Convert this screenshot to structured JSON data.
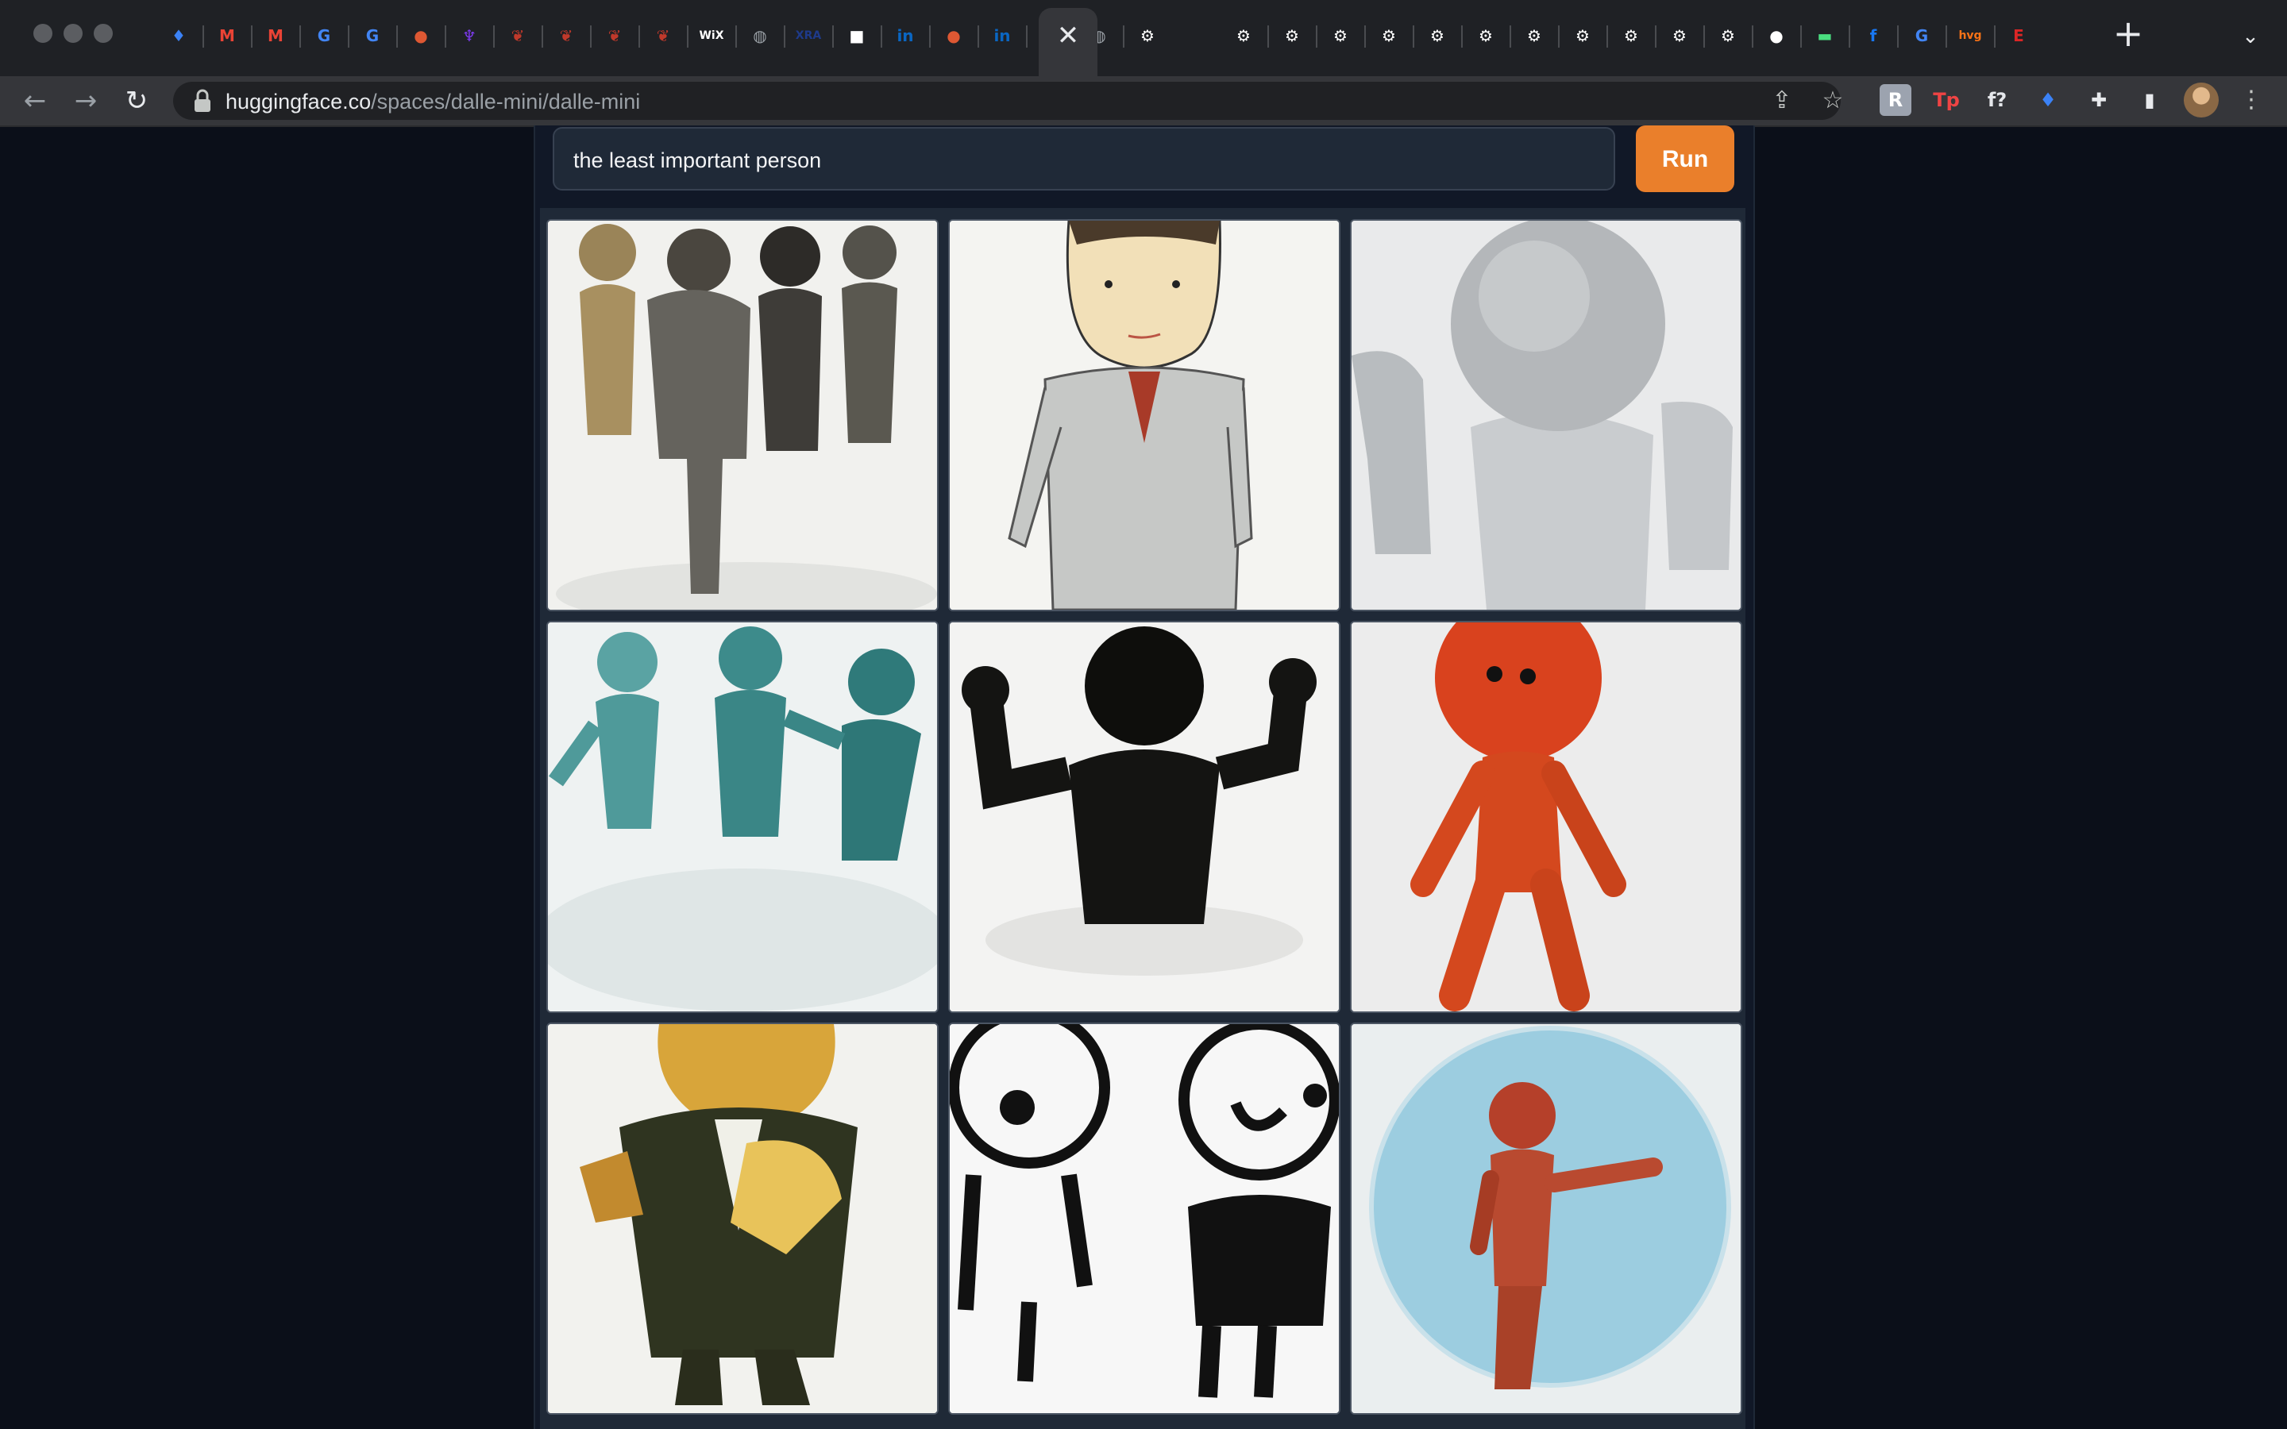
{
  "browser": {
    "active_tab_close_icon": "close-icon",
    "new_tab_label": "+",
    "url": {
      "domain": "huggingface.co",
      "path": "/spaces/dalle-mini/dalle-mini"
    },
    "tab_favicons": [
      {
        "icon": "diamond-icon",
        "text": "♦",
        "color": "#3b82f6"
      },
      {
        "icon": "gmail-icon",
        "text": "M",
        "color": "#ea4335"
      },
      {
        "icon": "gmail-icon",
        "text": "M",
        "color": "#ea4335"
      },
      {
        "icon": "google-icon",
        "text": "G",
        "color": "#4285f4"
      },
      {
        "icon": "google-icon",
        "text": "G",
        "color": "#4285f4"
      },
      {
        "icon": "duckduckgo-icon",
        "text": "●",
        "color": "#de5833"
      },
      {
        "icon": "purple-app-icon",
        "text": "♆",
        "color": "#7c3aed"
      },
      {
        "icon": "red-flag-icon",
        "text": "❦",
        "color": "#c0392b"
      },
      {
        "icon": "red-flag-icon",
        "text": "❦",
        "color": "#c0392b"
      },
      {
        "icon": "red-flag-icon",
        "text": "❦",
        "color": "#c0392b"
      },
      {
        "icon": "red-flag-icon",
        "text": "❦",
        "color": "#c0392b"
      },
      {
        "icon": "wix-icon",
        "text": "WiX",
        "color": "#ffffff"
      },
      {
        "icon": "globe-icon",
        "text": "◍",
        "color": "#9aa0a6"
      },
      {
        "icon": "xra-icon",
        "text": "XRA",
        "color": "#1e3a8a"
      },
      {
        "icon": "white-square-icon",
        "text": "■",
        "color": "#ffffff"
      },
      {
        "icon": "linkedin-icon",
        "text": "in",
        "color": "#0a66c2"
      },
      {
        "icon": "duckduckgo-icon",
        "text": "●",
        "color": "#de5833"
      },
      {
        "icon": "linkedin-icon",
        "text": "in",
        "color": "#0a66c2"
      },
      {
        "icon": "linkedin-icon",
        "text": "in",
        "color": "#0a66c2"
      },
      {
        "icon": "globe-icon",
        "text": "◍",
        "color": "#9aa0a6"
      },
      {
        "icon": "gear-icon",
        "text": "⚙",
        "color": "#ffffff"
      },
      {
        "icon": "gear-icon",
        "text": "⚙",
        "color": "#ffffff"
      },
      {
        "icon": "gear-icon",
        "text": "⚙",
        "color": "#ffffff"
      },
      {
        "icon": "gear-icon",
        "text": "⚙",
        "color": "#ffffff"
      },
      {
        "icon": "gear-icon",
        "text": "⚙",
        "color": "#ffffff"
      },
      {
        "icon": "gear-icon",
        "text": "⚙",
        "color": "#ffffff"
      },
      {
        "icon": "gear-icon",
        "text": "⚙",
        "color": "#ffffff"
      },
      {
        "icon": "gear-icon",
        "text": "⚙",
        "color": "#ffffff"
      },
      {
        "icon": "gear-icon",
        "text": "⚙",
        "color": "#ffffff"
      },
      {
        "icon": "gear-icon",
        "text": "⚙",
        "color": "#ffffff"
      },
      {
        "icon": "gear-icon",
        "text": "⚙",
        "color": "#ffffff"
      },
      {
        "icon": "gear-icon",
        "text": "⚙",
        "color": "#ffffff"
      },
      {
        "icon": "github-icon",
        "text": "●",
        "color": "#ffffff"
      },
      {
        "icon": "green-app-icon",
        "text": "▬",
        "color": "#4ade80"
      },
      {
        "icon": "facebook-icon",
        "text": "f",
        "color": "#1877f2"
      },
      {
        "icon": "google-icon",
        "text": "G",
        "color": "#4285f4"
      },
      {
        "icon": "hvg-icon",
        "text": "hvg",
        "color": "#f97316"
      },
      {
        "icon": "e-icon",
        "text": "E",
        "color": "#dc2626"
      }
    ],
    "extensions": [
      {
        "icon": "r-extension-icon",
        "text": "R",
        "color": "#d1d5db"
      },
      {
        "icon": "tp-extension-icon",
        "text": "Tp",
        "color": "#ef4444"
      },
      {
        "icon": "function-extension-icon",
        "text": "f?",
        "color": "#e5e7eb"
      },
      {
        "icon": "diamond-extension-icon",
        "text": "♦",
        "color": "#3b82f6"
      },
      {
        "icon": "puzzle-icon",
        "text": "✚",
        "color": "#e8eaed"
      },
      {
        "icon": "side-panel-icon",
        "text": "▮",
        "color": "#e8eaed"
      }
    ]
  },
  "app": {
    "prompt_value": "the least important person",
    "run_label": "Run",
    "accent_color": "#ea7f2b",
    "images": [
      {
        "label": "group-of-grey-3d-figures"
      },
      {
        "label": "sketched-businessman"
      },
      {
        "label": "grey-sphere-head-figures"
      },
      {
        "label": "teal-figures-reflection"
      },
      {
        "label": "black-silhouette-arms-up"
      },
      {
        "label": "orange-figure-standing"
      },
      {
        "label": "figure-holding-papers"
      },
      {
        "label": "ink-doodle-faces"
      },
      {
        "label": "red-figure-blue-circle"
      }
    ]
  }
}
